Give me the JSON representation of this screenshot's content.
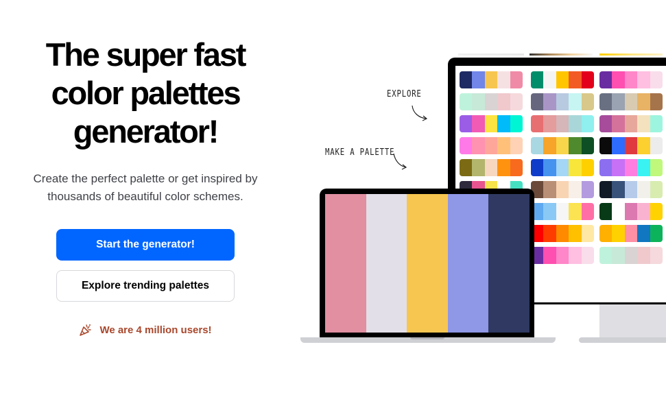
{
  "hero": {
    "title_line1": "The super fast",
    "title_line2": "color palettes",
    "title_line3": "generator!",
    "subtitle": "Create the perfect palette or get inspired by thousands of beautiful color schemes.",
    "primary_button": "Start the generator!",
    "secondary_button": "Explore trending palettes",
    "users_text": "We are 4 million users!"
  },
  "annotations": {
    "explore": "EXPLORE",
    "make_palette": "MAKE A PALETTE"
  },
  "colors": {
    "primary": "#0066ff",
    "users_text": "#a9472c",
    "laptop_palette": [
      "#e18fa1",
      "#e2dfe8",
      "#f7c650",
      "#8f97e7",
      "#2f3961"
    ]
  },
  "monitor_palettes": [
    [
      "#1e2a63",
      "#7186e8",
      "#f7c650",
      "#f6e1e2",
      "#f08ba7"
    ],
    [
      "#008e6a",
      "#f4f4f4",
      "#ffc600",
      "#f35b25",
      "#e3001b"
    ],
    [
      "#6a2ca1",
      "#ff4fb0",
      "#ff86c8",
      "#ffbfe1",
      "#f9ddea"
    ],
    [
      "#bff2dc",
      "#c7e9d7",
      "#d9d4d3",
      "#f0c9cd",
      "#f6d9dc"
    ],
    [
      "#66667f",
      "#a996c7",
      "#b8cae0",
      "#c6f5f2",
      "#d8c88a"
    ],
    [
      "#687081",
      "#9aa3b1",
      "#d8cbb2",
      "#e8b365",
      "#a6744a"
    ],
    [
      "#9b5de5",
      "#f15bb5",
      "#fee440",
      "#00bbf9",
      "#00f5d4"
    ],
    [
      "#e76f72",
      "#e49c9c",
      "#d6b6b8",
      "#a9d7d9",
      "#8ff0ef"
    ],
    [
      "#a64c9b",
      "#d5729b",
      "#e8a79b",
      "#f4e2be",
      "#9ef5df"
    ],
    [
      "#ff7ae8",
      "#ff92b0",
      "#ffa69a",
      "#ffc17a",
      "#ffd2b5"
    ],
    [
      "#a9d8e3",
      "#f6a42a",
      "#f8d54a",
      "#4f8a2e",
      "#0f4f24"
    ],
    [
      "#0b0b0b",
      "#2e6bff",
      "#e03a3e",
      "#fcd02e",
      "#ececec"
    ],
    [
      "#7c6b14",
      "#b3b56c",
      "#f7d7c0",
      "#ff9310",
      "#f86a1e"
    ],
    [
      "#0f3cc9",
      "#4692ef",
      "#a4d6f6",
      "#f8e63a",
      "#ffd000"
    ],
    [
      "#8c6ff0",
      "#c771f6",
      "#ff7ee0",
      "#3af2f2",
      "#bff87a"
    ],
    [
      "#2e2a3c",
      "#e8548f",
      "#f7e34a",
      "#ffffff",
      "#45e0c2"
    ],
    [
      "#6b4a39",
      "#b98f76",
      "#f8d4b3",
      "#f7efe8",
      "#b49bdf"
    ],
    [
      "#111a27",
      "#39527a",
      "#b6cbe9",
      "#f2f0ea",
      "#d8ecb0"
    ],
    [
      "#2e6f86",
      "#4ea3b7",
      "#89c6cf",
      "#f1eedf",
      "#f8a62a"
    ],
    [
      "#5ea9f0",
      "#8ac9f5",
      "#f6f6f6",
      "#fbe351",
      "#ff6fa6"
    ],
    [
      "#083a17",
      "#ffffff",
      "#dc79b0",
      "#f9b3d1",
      "#ffd200"
    ],
    [
      "#463e3a",
      "#8b8079",
      "#b8b0a7",
      "#f2efea",
      "#e9b7a5"
    ],
    [
      "#ff0000",
      "#ff3c00",
      "#ff8a00",
      "#ffc000",
      "#ffe8a4"
    ],
    [
      "#ffb000",
      "#ffd100",
      "#ff8fa5",
      "#1177c0",
      "#0db35a"
    ],
    [
      "#008e6a",
      "#f4f4f4",
      "#ffc600",
      "#f35b25",
      "#e3001b"
    ],
    [
      "#6a2ca1",
      "#ff4fb0",
      "#ff86c8",
      "#ffbfe1",
      "#f9ddea"
    ],
    [
      "#bff2dc",
      "#c7e9d7",
      "#d9d4d3",
      "#f0c9cd",
      "#f6d9dc"
    ],
    [
      "#687081",
      "#9aa3b1",
      "#d8cbb2",
      "#e8b365",
      "#a6744a"
    ]
  ]
}
